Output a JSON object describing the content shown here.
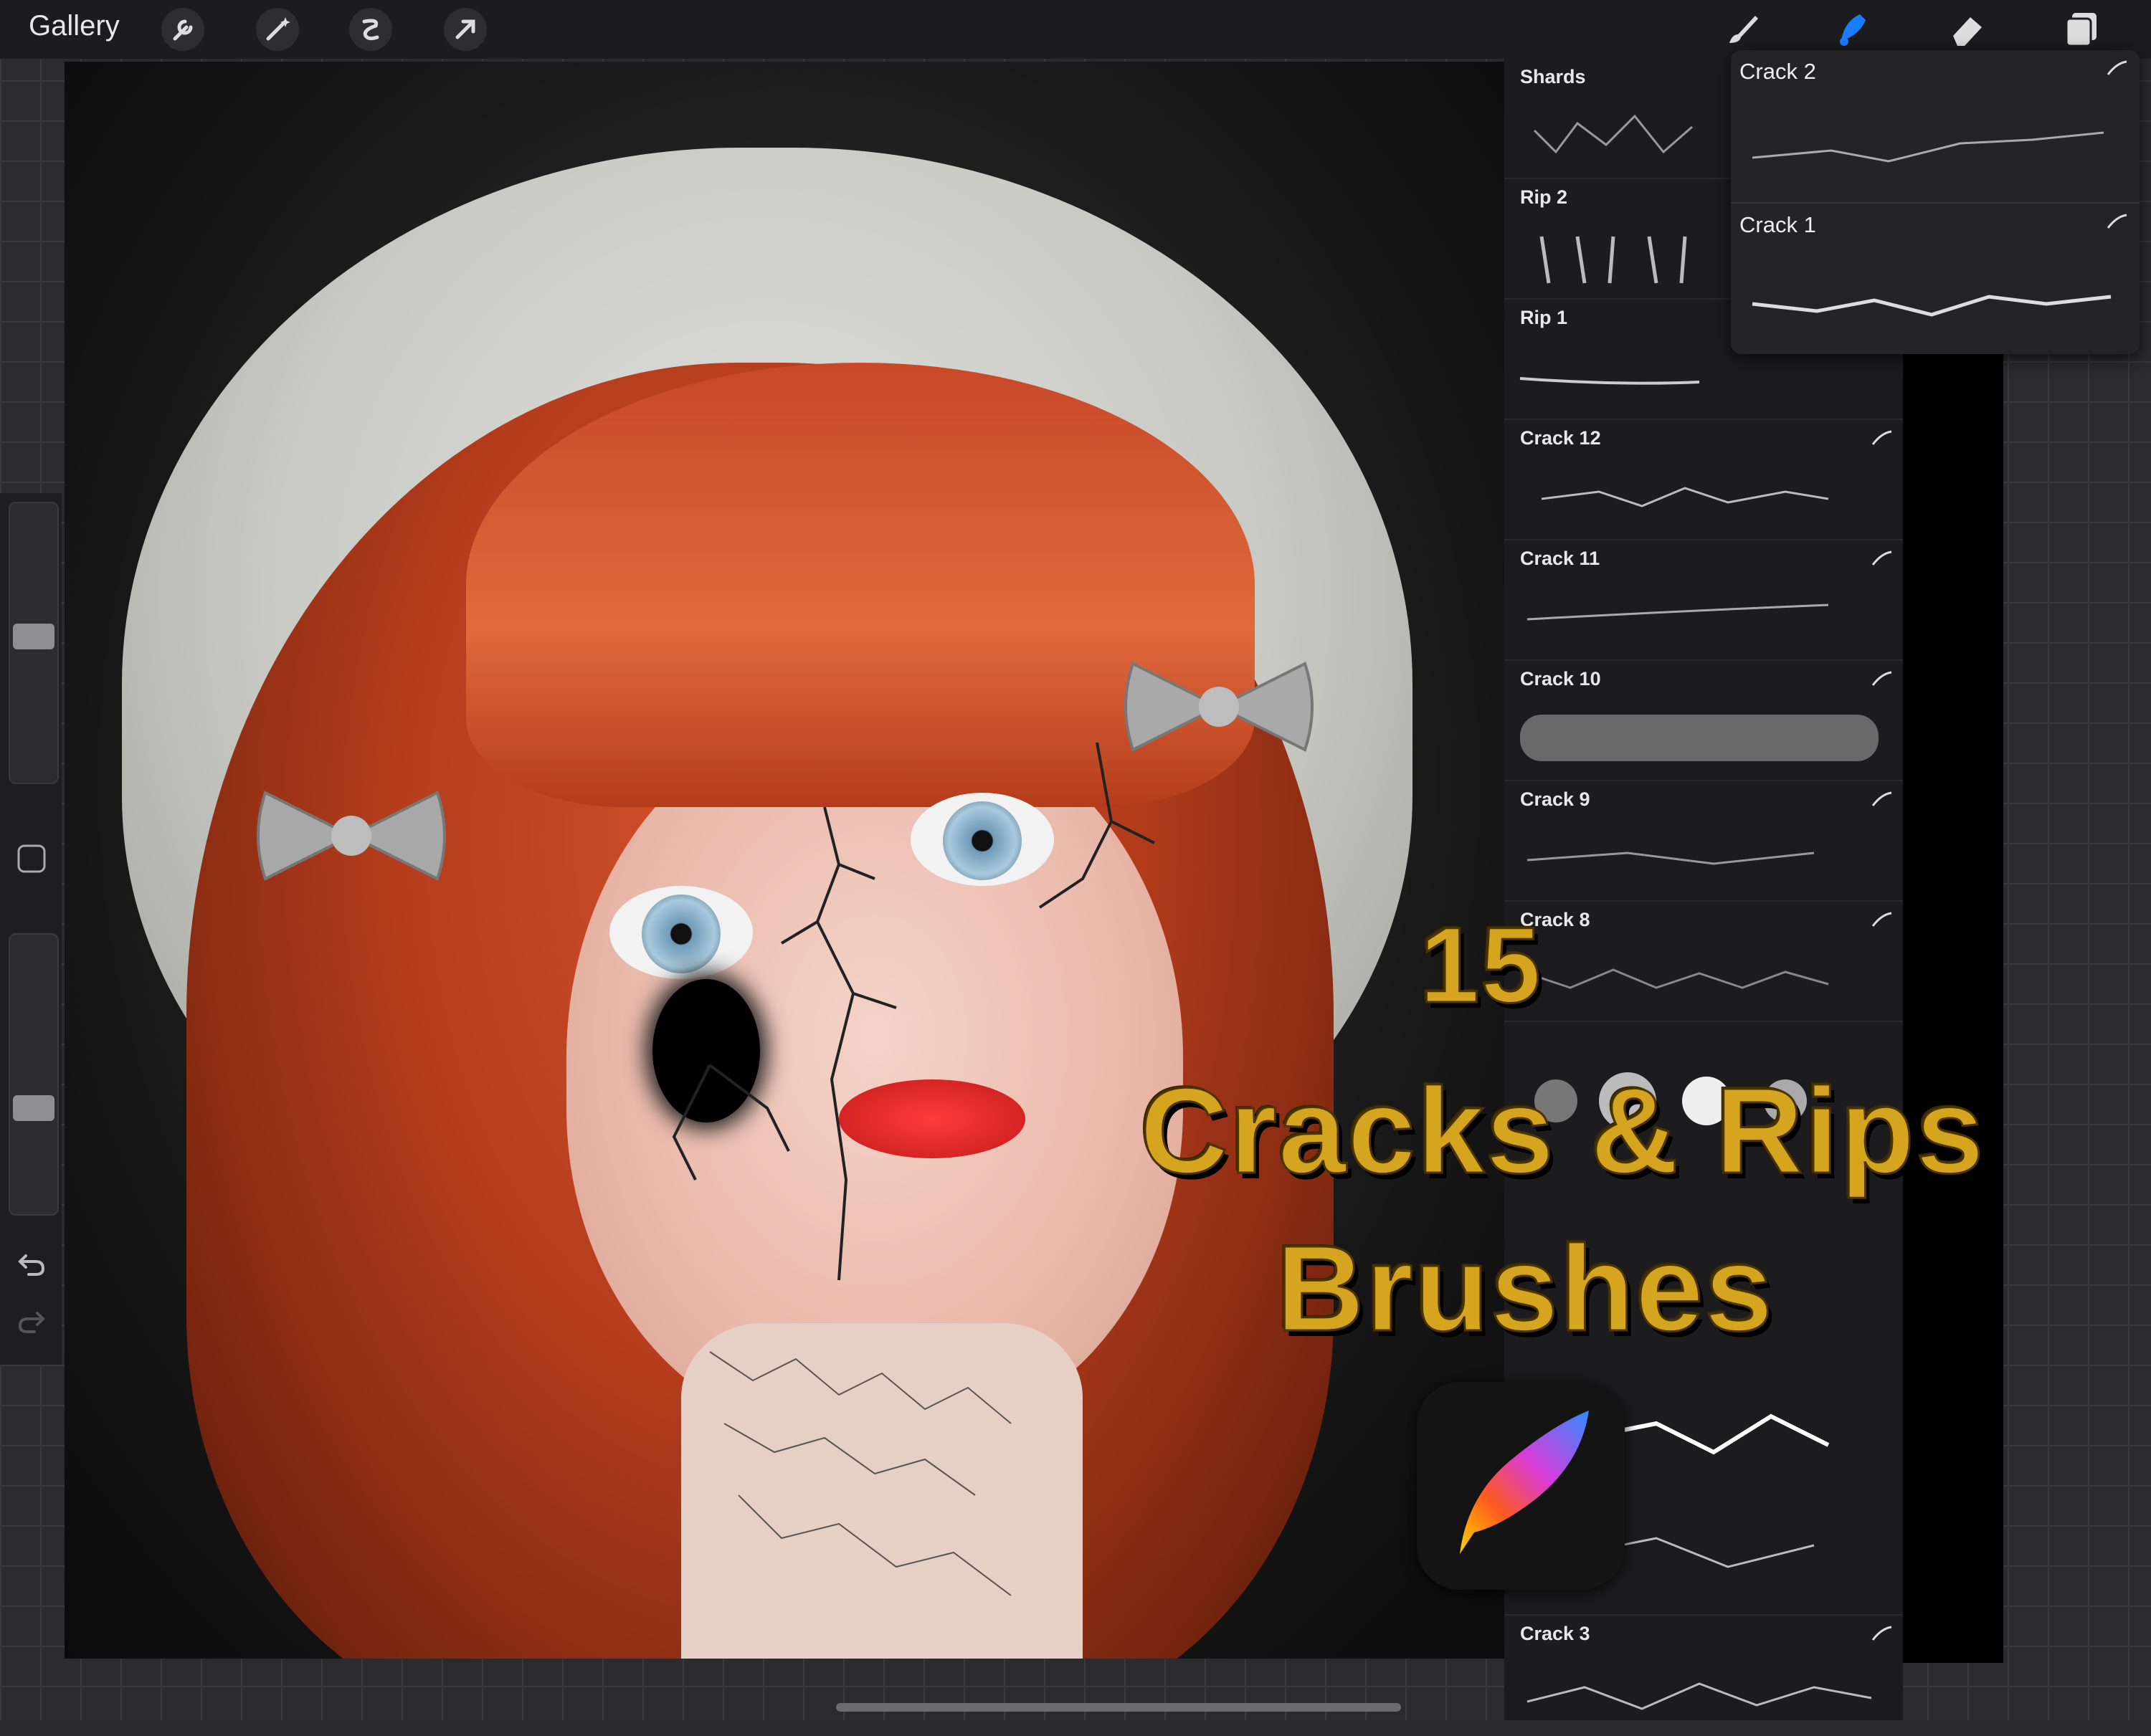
{
  "topbar": {
    "gallery_label": "Gallery",
    "left_tools": [
      "wrench-icon",
      "magic-wand-icon",
      "selection-icon",
      "transform-arrow-icon"
    ],
    "right_tools": [
      "brush-icon",
      "smudge-icon",
      "eraser-icon",
      "layers-icon"
    ],
    "active_tool_color": "#1a7cff"
  },
  "sidebar": {
    "brush_size_level": 0.52,
    "opacity_level": 0.36,
    "icons": [
      "modifier-square-icon",
      "undo-icon",
      "redo-icon"
    ]
  },
  "brush_library": {
    "brushes": [
      {
        "name": "Shards"
      },
      {
        "name": "Rip 2"
      },
      {
        "name": "Rip 1"
      },
      {
        "name": "Crack 12"
      },
      {
        "name": "Crack 11"
      },
      {
        "name": "Crack 10"
      },
      {
        "name": "Crack 9"
      },
      {
        "name": "Crack 8"
      },
      {
        "name": "Crack 3"
      }
    ]
  },
  "recent_popover": {
    "items": [
      {
        "name": "Crack 2"
      },
      {
        "name": "Crack 1"
      }
    ]
  },
  "headline": {
    "line1": "15",
    "line2": "Cracks & Rips",
    "line3": "Brushes",
    "color": "#d6a520"
  },
  "colors": {
    "hair": "#c84827",
    "bonnet": "#d9d9d4",
    "lips": "#e02424",
    "panel": "#1c1c1e"
  }
}
